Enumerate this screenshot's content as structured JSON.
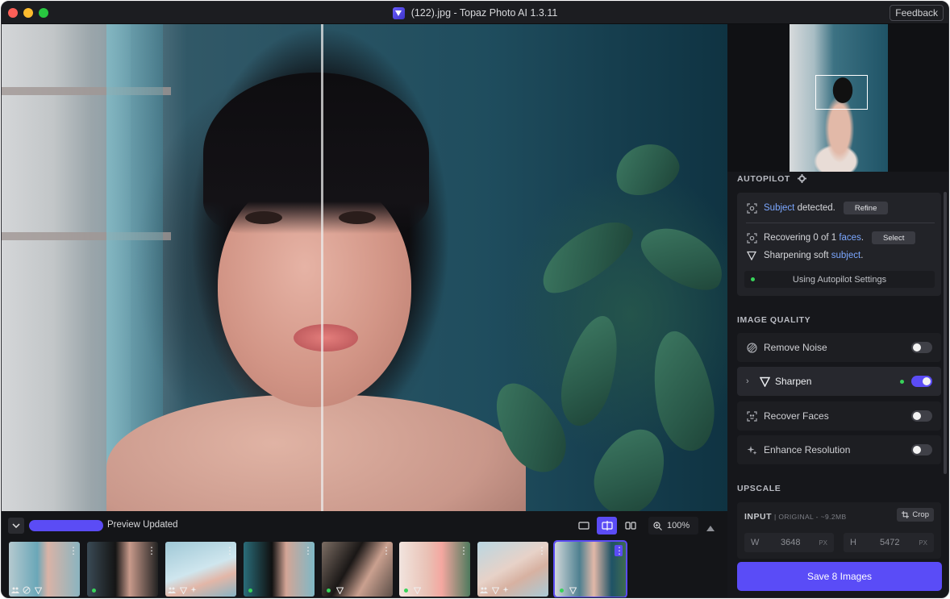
{
  "window": {
    "title": "(122).jpg - Topaz Photo AI 1.3.11",
    "feedback_label": "Feedback"
  },
  "autopilot": {
    "label": "AUTOPILOT",
    "subject_link": "Subject",
    "subject_text": "detected.",
    "refine_label": "Refine",
    "recovering_text": "Recovering 0 of 1",
    "faces_link": "faces",
    "faces_suffix": ".",
    "select_label": "Select",
    "sharpening_text": "Sharpening soft",
    "subject_link2": "subject",
    "subject_suffix": ".",
    "settings_label": "Using Autopilot Settings"
  },
  "image_quality": {
    "label": "IMAGE QUALITY",
    "items": [
      {
        "label": "Remove Noise",
        "enabled": false,
        "icon": "remove-noise-icon"
      },
      {
        "label": "Sharpen",
        "enabled": true,
        "icon": "sharpen-icon"
      },
      {
        "label": "Recover Faces",
        "enabled": false,
        "icon": "recover-faces-icon"
      },
      {
        "label": "Enhance Resolution",
        "enabled": false,
        "icon": "enhance-resolution-icon"
      }
    ]
  },
  "upscale": {
    "label": "UPSCALE",
    "input_label": "INPUT",
    "original_info": "| ORIGINAL - ~9.2MB",
    "crop_label": "Crop",
    "width_key": "W",
    "width_value": "3648",
    "height_key": "H",
    "height_value": "5472",
    "unit": "PX"
  },
  "save_label": "Save 8 Images",
  "bottom": {
    "preview_status": "Preview Updated",
    "zoom": "100%",
    "view_modes": [
      "single-view",
      "split-view",
      "side-by-side-view"
    ],
    "selected_view": "split-view"
  },
  "thumbnails": {
    "count": 8,
    "selected_index": 7,
    "more_label": "⋮"
  },
  "colors": {
    "accent": "#5b4cf5",
    "link": "#7ba7ff",
    "status_green": "#38d35a"
  }
}
